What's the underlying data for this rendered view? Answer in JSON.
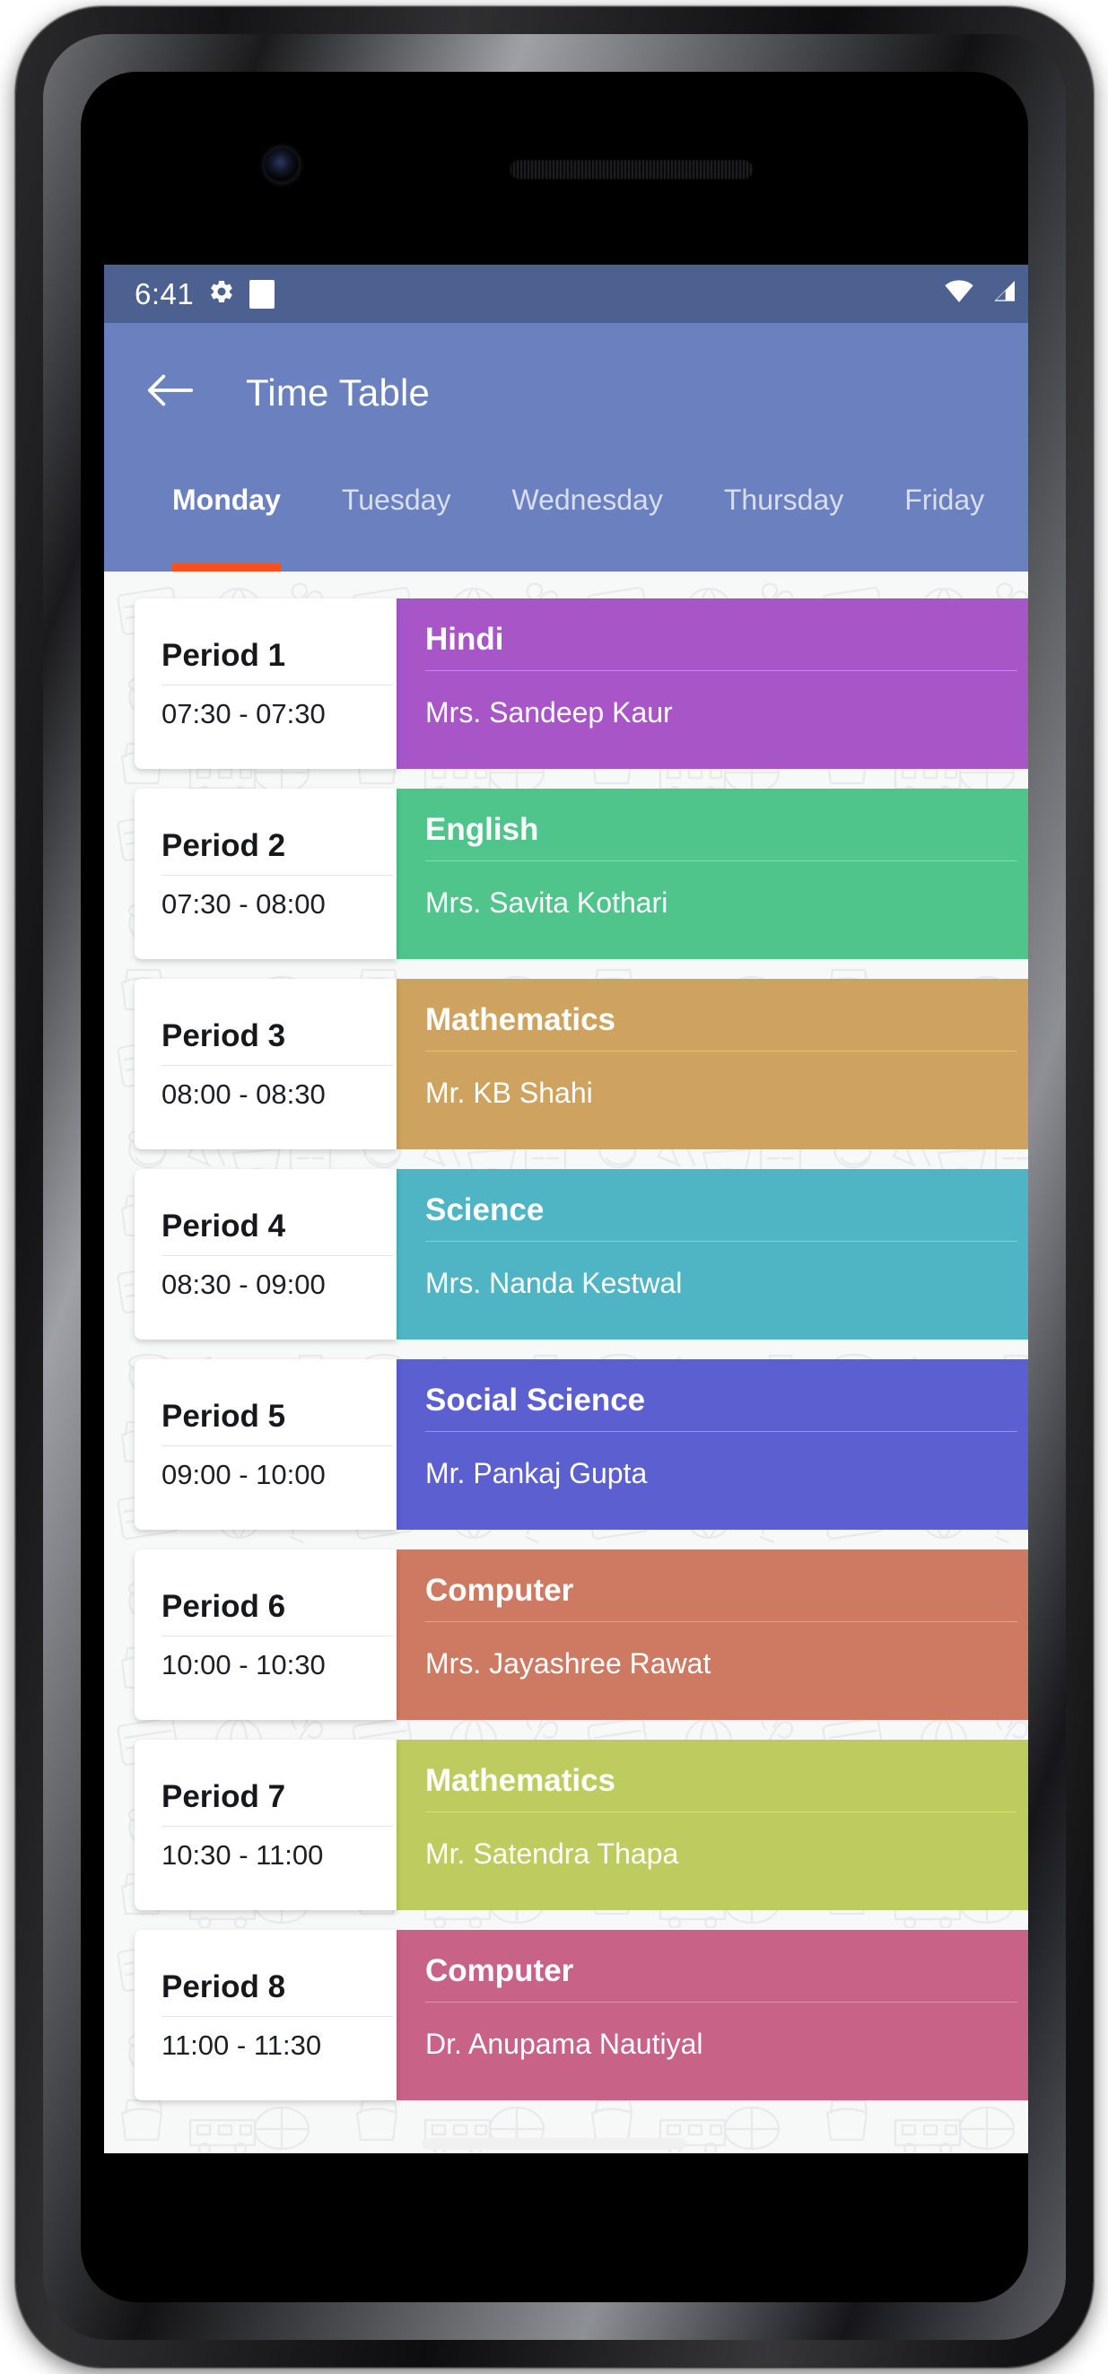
{
  "status_bar": {
    "time": "6:41",
    "left_icons": [
      "gear-icon",
      "white-square-icon"
    ],
    "right_icons": [
      "wifi-icon",
      "cell-signal-icon",
      "battery-icon"
    ],
    "background_color": "#4C6190"
  },
  "app_bar": {
    "back_icon": "back-arrow-icon",
    "title": "Time Table",
    "background_color": "#6B80BE"
  },
  "tabs": {
    "active_index": 0,
    "indicator_color": "#F4511E",
    "items": [
      {
        "label": "Monday"
      },
      {
        "label": "Tuesday"
      },
      {
        "label": "Wednesday"
      },
      {
        "label": "Thursday"
      },
      {
        "label": "Friday"
      }
    ]
  },
  "timetable": {
    "rows": [
      {
        "period": "Period 1",
        "time": "07:30 - 07:30",
        "subject": "Hindi",
        "teacher": "Mrs. Sandeep Kaur",
        "color": "#A855C8"
      },
      {
        "period": "Period 2",
        "time": "07:30 - 08:00",
        "subject": "English",
        "teacher": "Mrs. Savita Kothari",
        "color": "#4FC58B"
      },
      {
        "period": "Period 3",
        "time": "08:00 - 08:30",
        "subject": "Mathematics",
        "teacher": "Mr. KB Shahi",
        "color": "#CEA35F"
      },
      {
        "period": "Period 4",
        "time": "08:30 - 09:00",
        "subject": "Science",
        "teacher": "Mrs. Nanda Kestwal",
        "color": "#4FB5C4"
      },
      {
        "period": "Period 5",
        "time": "09:00 - 10:00",
        "subject": "Social Science",
        "teacher": "Mr. Pankaj Gupta",
        "color": "#5B5FD0"
      },
      {
        "period": "Period 6",
        "time": "10:00 - 10:30",
        "subject": "Computer",
        "teacher": "Mrs. Jayashree Rawat",
        "color": "#CE7A62"
      },
      {
        "period": "Period 7",
        "time": "10:30 - 11:00",
        "subject": "Mathematics",
        "teacher": "Mr. Satendra Thapa",
        "color": "#BECB5E"
      },
      {
        "period": "Period 8",
        "time": "11:00 - 11:30",
        "subject": "Computer",
        "teacher": "Dr. Anupama Nautiyal",
        "color": "#C96287"
      }
    ]
  },
  "device": {
    "front_camera_icon": "front-camera-icon",
    "earpiece_icon": "earpiece-speaker-icon",
    "home_indicator_icon": "home-indicator-bar"
  }
}
